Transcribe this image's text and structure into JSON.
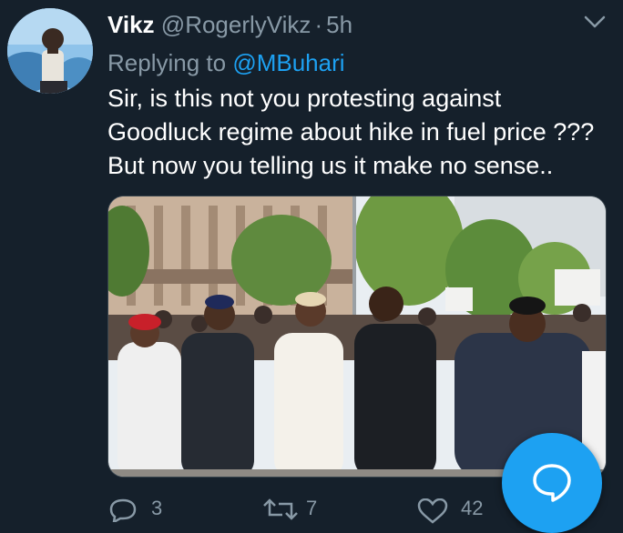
{
  "tweet": {
    "author_name": "Vikz",
    "author_handle": "@RogerlyVikz",
    "separator": "·",
    "time": "5h",
    "replying_label": "Replying to",
    "replying_to": "@MBuhari",
    "text_lines": [
      "Sir, is this not you protesting against",
      "Goodluck regime about hike in fuel price ???",
      "But now you telling us it make no sense.."
    ],
    "replies": "3",
    "retweets": "7",
    "likes": "42"
  },
  "icons": {
    "menu": "chevron-down-icon",
    "reply": "reply-icon",
    "retweet": "retweet-icon",
    "like": "heart-icon",
    "share": "share-icon",
    "compose": "compose-message-icon"
  },
  "colors": {
    "background": "#15202b",
    "secondary_text": "#8899a6",
    "accent": "#1da1f2",
    "primary_text": "#ffffff"
  }
}
